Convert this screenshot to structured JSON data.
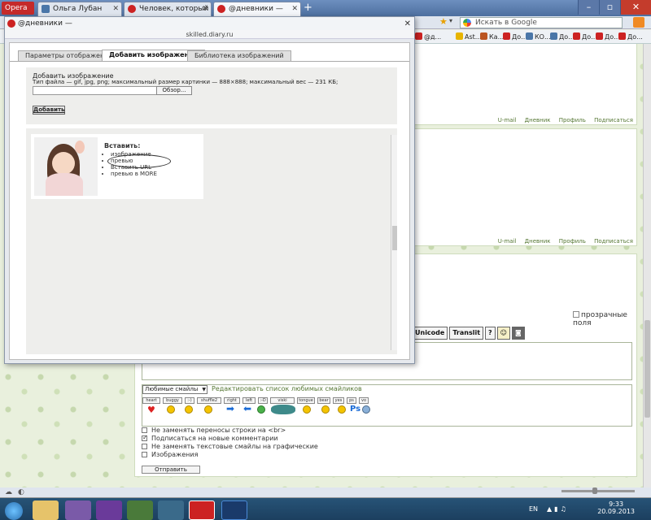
{
  "browser": {
    "menu_label": "Opera",
    "tabs": [
      {
        "label": "Ольга Лубан"
      },
      {
        "label": "Человек, который под..."
      },
      {
        "label": "@дневники —"
      }
    ],
    "new_tab_symbol": "+",
    "search_placeholder": "Искать в Google",
    "bookmarks": [
      {
        "label": "@д..."
      },
      {
        "label": "Ast..."
      },
      {
        "label": "Ка..."
      },
      {
        "label": "До..."
      },
      {
        "label": "КО..."
      },
      {
        "label": "До..."
      },
      {
        "label": "До..."
      },
      {
        "label": "До..."
      },
      {
        "label": "До..."
      },
      {
        "label": "До..."
      }
    ]
  },
  "page": {
    "profile_links": "U-mail Дневник Профиль Подписаться",
    "transparent_fields": "прозрачные поля",
    "format_buttons": [
      "Unicode",
      "Translit",
      "?"
    ],
    "smiles_select": "Любимые смайлы",
    "edit_smiles_link": "Редактировать список любимых смайликов",
    "smile_tags": [
      "heart",
      "buggy",
      ":-)",
      "shuffle2",
      "right",
      "left",
      ":-D",
      "viski",
      "tongue",
      "bear",
      "yes",
      "ps",
      "vo"
    ],
    "options": [
      {
        "label": "Не заменять переносы строки на <br>",
        "checked": false
      },
      {
        "label": "Подписаться на новые комментарии",
        "checked": true
      },
      {
        "label": "Не заменять текстовые смайлы на графические",
        "checked": false
      },
      {
        "label": "Изображения",
        "checked": false
      }
    ],
    "send_label": "Отправить"
  },
  "popup": {
    "title": "@дневники —",
    "url": "skilled.diary.ru",
    "tabs": [
      {
        "label": "Параметры отображения"
      },
      {
        "label": "Добавить изображения"
      },
      {
        "label": "Библиотека изображений"
      }
    ],
    "upload_title": "Добавить изображение",
    "upload_info": "Тип файла — gif, jpg, png; максимальный размер картинки — 888×888; максимальный вес — 231 КБ;",
    "browse_label": "Обзор...",
    "add_label": "Добавить",
    "insert_label": "Вставить:",
    "insert_options": [
      "изображение",
      "превью",
      "Вставить URL",
      "превью в MORE"
    ]
  },
  "taskbar": {
    "language": "EN",
    "time": "9:33",
    "date": "20.09.2013"
  }
}
